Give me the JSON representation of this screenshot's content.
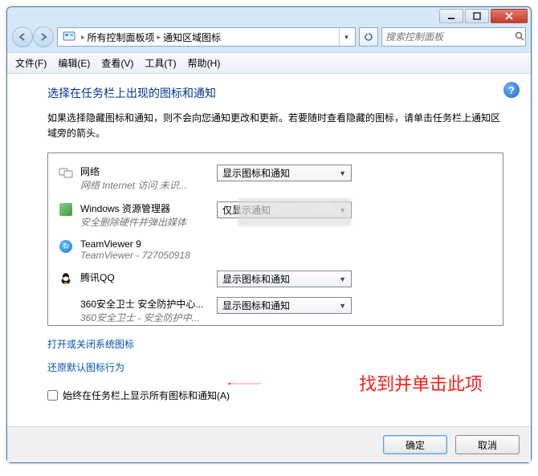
{
  "window": {
    "breadcrumb": {
      "root": "所有控制面板项",
      "leaf": "通知区域图标"
    },
    "search_placeholder": "搜索控制面板"
  },
  "menu": {
    "file": "文件(F)",
    "edit": "编辑(E)",
    "view": "查看(V)",
    "tools": "工具(T)",
    "help": "帮助(H)"
  },
  "content": {
    "heading": "选择在任务栏上出现的图标和通知",
    "desc": "如果选择隐藏图标和通知，则不会向您通知更改和更新。若要随时查看隐藏的图标，请单击任务栏上通知区域旁的箭头。",
    "items": [
      {
        "name": "网络",
        "sub": "网络 Internet 访问 未识...",
        "option": "显示图标和通知",
        "icon": "network-icon"
      },
      {
        "name": "Windows 资源管理器",
        "sub": "安全删除硬件并弹出媒体",
        "option": "仅显示通知",
        "icon": "explorer-icon"
      },
      {
        "name": "TeamViewer 9",
        "sub": "TeamViewer - 727050918",
        "option": "",
        "icon": "teamviewer-icon"
      },
      {
        "name": "腾讯QQ",
        "sub": "",
        "option": "显示图标和通知",
        "icon": "qq-icon"
      },
      {
        "name": "360安全卫士 安全防护中心...",
        "sub": "360安全卫士 - 安全防护中...",
        "option": "显示图标和通知",
        "icon": "360-icon"
      }
    ],
    "link_open_close": "打开或关闭系统图标",
    "link_restore": "还原默认图标行为",
    "checkbox_label": "始终在任务栏上显示所有图标和通知(A)"
  },
  "footer": {
    "ok": "确定",
    "cancel": "取消"
  },
  "annotation": {
    "text": "找到并单击此项"
  }
}
